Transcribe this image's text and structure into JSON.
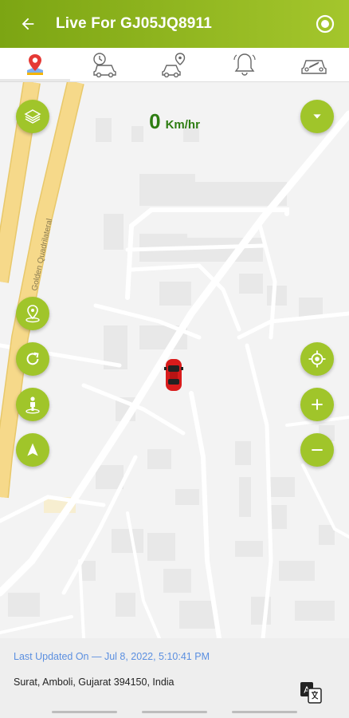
{
  "appbar": {
    "title": "Live For GJ05JQ8911",
    "back_icon": "arrow-left-icon",
    "record_icon": "record-circle-icon",
    "colors": {
      "gradient_start": "#7ca513",
      "gradient_end": "#a4c62c"
    }
  },
  "tabs": [
    {
      "name": "live-map",
      "icon": "map-pin-icon",
      "active": true
    },
    {
      "name": "history",
      "icon": "car-clock-icon",
      "active": false
    },
    {
      "name": "trip",
      "icon": "car-location-icon",
      "active": false
    },
    {
      "name": "alerts",
      "icon": "bell-icon",
      "active": false
    },
    {
      "name": "service",
      "icon": "car-wrench-icon",
      "active": false
    }
  ],
  "map": {
    "speed_value": "0",
    "speed_unit": "Km/hr",
    "road_label": "Golden Quadrilateral",
    "vehicle_icon": "red-car-icon",
    "left_buttons": [
      "layers-icon",
      "location-pin-icon",
      "refresh-icon",
      "person-pin-icon",
      "navigation-arrow-icon"
    ],
    "right_buttons": [
      "chevron-down-icon",
      "my-location-icon",
      "zoom-in-icon",
      "zoom-out-icon"
    ],
    "accent_color": "#a0c52a"
  },
  "footer": {
    "last_updated": "Last Updated On — Jul 8, 2022, 5:10:41 PM",
    "address": "Surat, Amboli, Gujarat 394150, India",
    "translate_icon": "translate-icon"
  }
}
